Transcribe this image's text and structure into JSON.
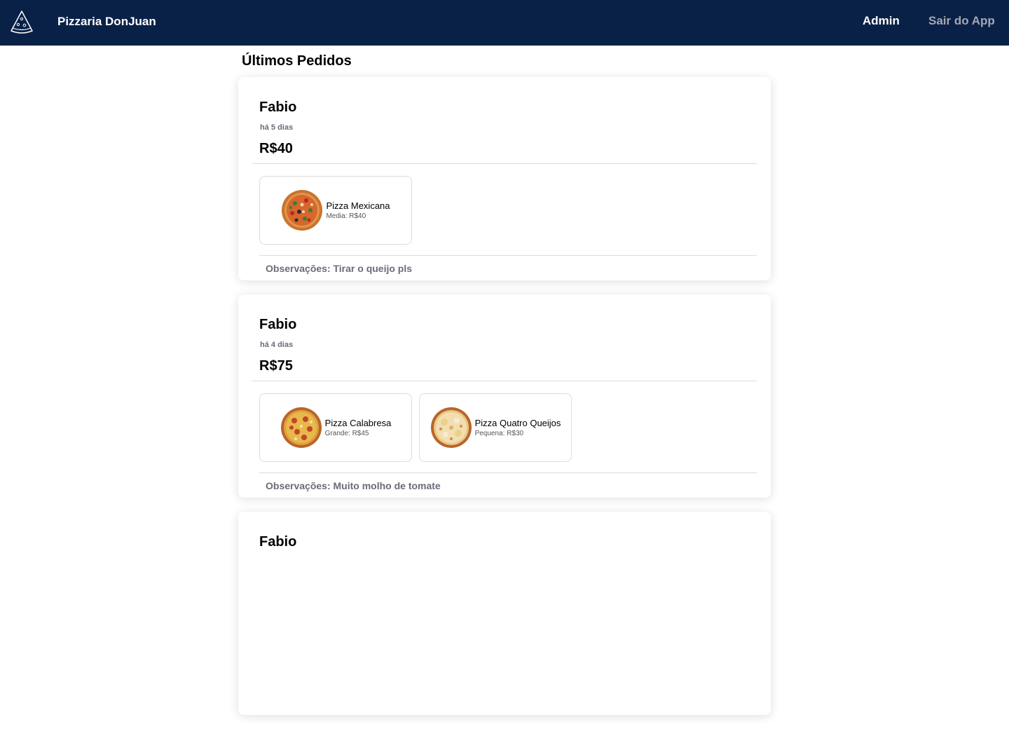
{
  "header": {
    "brand": "Pizzaria DonJuan",
    "logo_icon": "pizza-slice-icon",
    "nav": {
      "admin": "Admin",
      "exit": "Sair do App"
    },
    "bg_color": "#0a2147"
  },
  "page": {
    "title": "Últimos Pedidos"
  },
  "orders": [
    {
      "customer": "Fabio",
      "time": "há 5 dias",
      "total": "R$40",
      "items": [
        {
          "name": "Pizza Mexicana",
          "detail": "Media: R$40",
          "image": "pizza-mexicana-image"
        }
      ],
      "notes": "Observações: Tirar o queijo pls"
    },
    {
      "customer": "Fabio",
      "time": "há 4 dias",
      "total": "R$75",
      "items": [
        {
          "name": "Pizza Calabresa",
          "detail": "Grande: R$45",
          "image": "pizza-calabresa-image"
        },
        {
          "name": "Pizza Quatro Queijos",
          "detail": "Pequena: R$30",
          "image": "pizza-quatro-queijos-image"
        }
      ],
      "notes": "Observações: Muito molho de tomate"
    },
    {
      "customer": "Fabio"
    }
  ]
}
